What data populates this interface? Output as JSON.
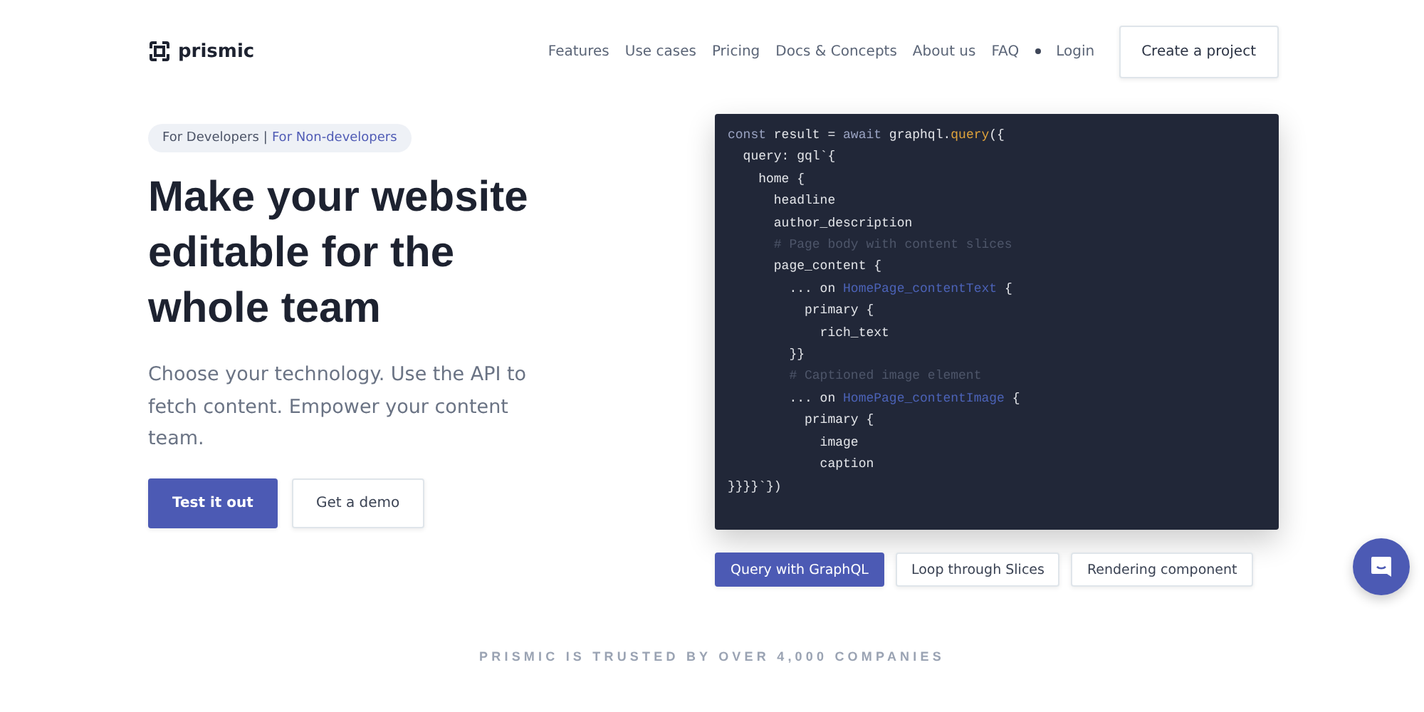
{
  "header": {
    "logo": "prismic",
    "nav": [
      "Features",
      "Use cases",
      "Pricing",
      "Docs & Concepts",
      "About us",
      "FAQ"
    ],
    "login": "Login",
    "cta": "Create a project"
  },
  "hero": {
    "audience": [
      {
        "label": "For Developers",
        "selected": true
      },
      {
        "label": "For Non-developers",
        "selected": false
      }
    ],
    "separator": "|",
    "headline": "Make your website editable for the whole team",
    "subtitle": "Choose your technology. Use the API to fetch content. Empower your content team.",
    "buttons": [
      {
        "label": "Test it out",
        "kind": "primary"
      },
      {
        "label": "Get a demo",
        "kind": "secondary"
      }
    ]
  },
  "code": {
    "lines": [
      [
        {
          "text": "const ",
          "kind": "keyword"
        },
        {
          "text": "result = ",
          "kind": "plain"
        },
        {
          "text": "await ",
          "kind": "keyword"
        },
        {
          "text": "graphql.",
          "kind": "plain"
        },
        {
          "text": "query",
          "kind": "func"
        },
        {
          "text": "({",
          "kind": "plain"
        }
      ],
      [
        {
          "text": "  query: gql`{",
          "kind": "plain"
        }
      ],
      [
        {
          "text": "    home {",
          "kind": "plain"
        }
      ],
      [
        {
          "text": "      headline",
          "kind": "plain"
        }
      ],
      [
        {
          "text": "      author_description",
          "kind": "plain"
        }
      ],
      [
        {
          "text": "      # Page body with content slices",
          "kind": "comment"
        }
      ],
      [
        {
          "text": "      page_content {",
          "kind": "plain"
        }
      ],
      [
        {
          "text": "        ... on ",
          "kind": "plain"
        },
        {
          "text": "HomePage_contentText",
          "kind": "type"
        },
        {
          "text": " {",
          "kind": "plain"
        }
      ],
      [
        {
          "text": "          primary {",
          "kind": "plain"
        }
      ],
      [
        {
          "text": "            rich_text",
          "kind": "plain"
        }
      ],
      [
        {
          "text": "        }}",
          "kind": "plain"
        }
      ],
      [
        {
          "text": "        # Captioned image element",
          "kind": "comment"
        }
      ],
      [
        {
          "text": "        ... on ",
          "kind": "plain"
        },
        {
          "text": "HomePage_contentImage",
          "kind": "type"
        },
        {
          "text": " {",
          "kind": "plain"
        }
      ],
      [
        {
          "text": "          primary {",
          "kind": "plain"
        }
      ],
      [
        {
          "text": "            image",
          "kind": "plain"
        }
      ],
      [
        {
          "text": "            caption",
          "kind": "plain"
        }
      ],
      [
        {
          "text": "}}}}`})",
          "kind": "plain"
        }
      ]
    ],
    "tabs": [
      {
        "label": "Query with GraphQL",
        "selected": true
      },
      {
        "label": "Loop through Slices",
        "selected": false
      },
      {
        "label": "Rendering component",
        "selected": false
      }
    ]
  },
  "trusted": "PRISMIC IS TRUSTED BY OVER 4,000 COMPANIES"
}
